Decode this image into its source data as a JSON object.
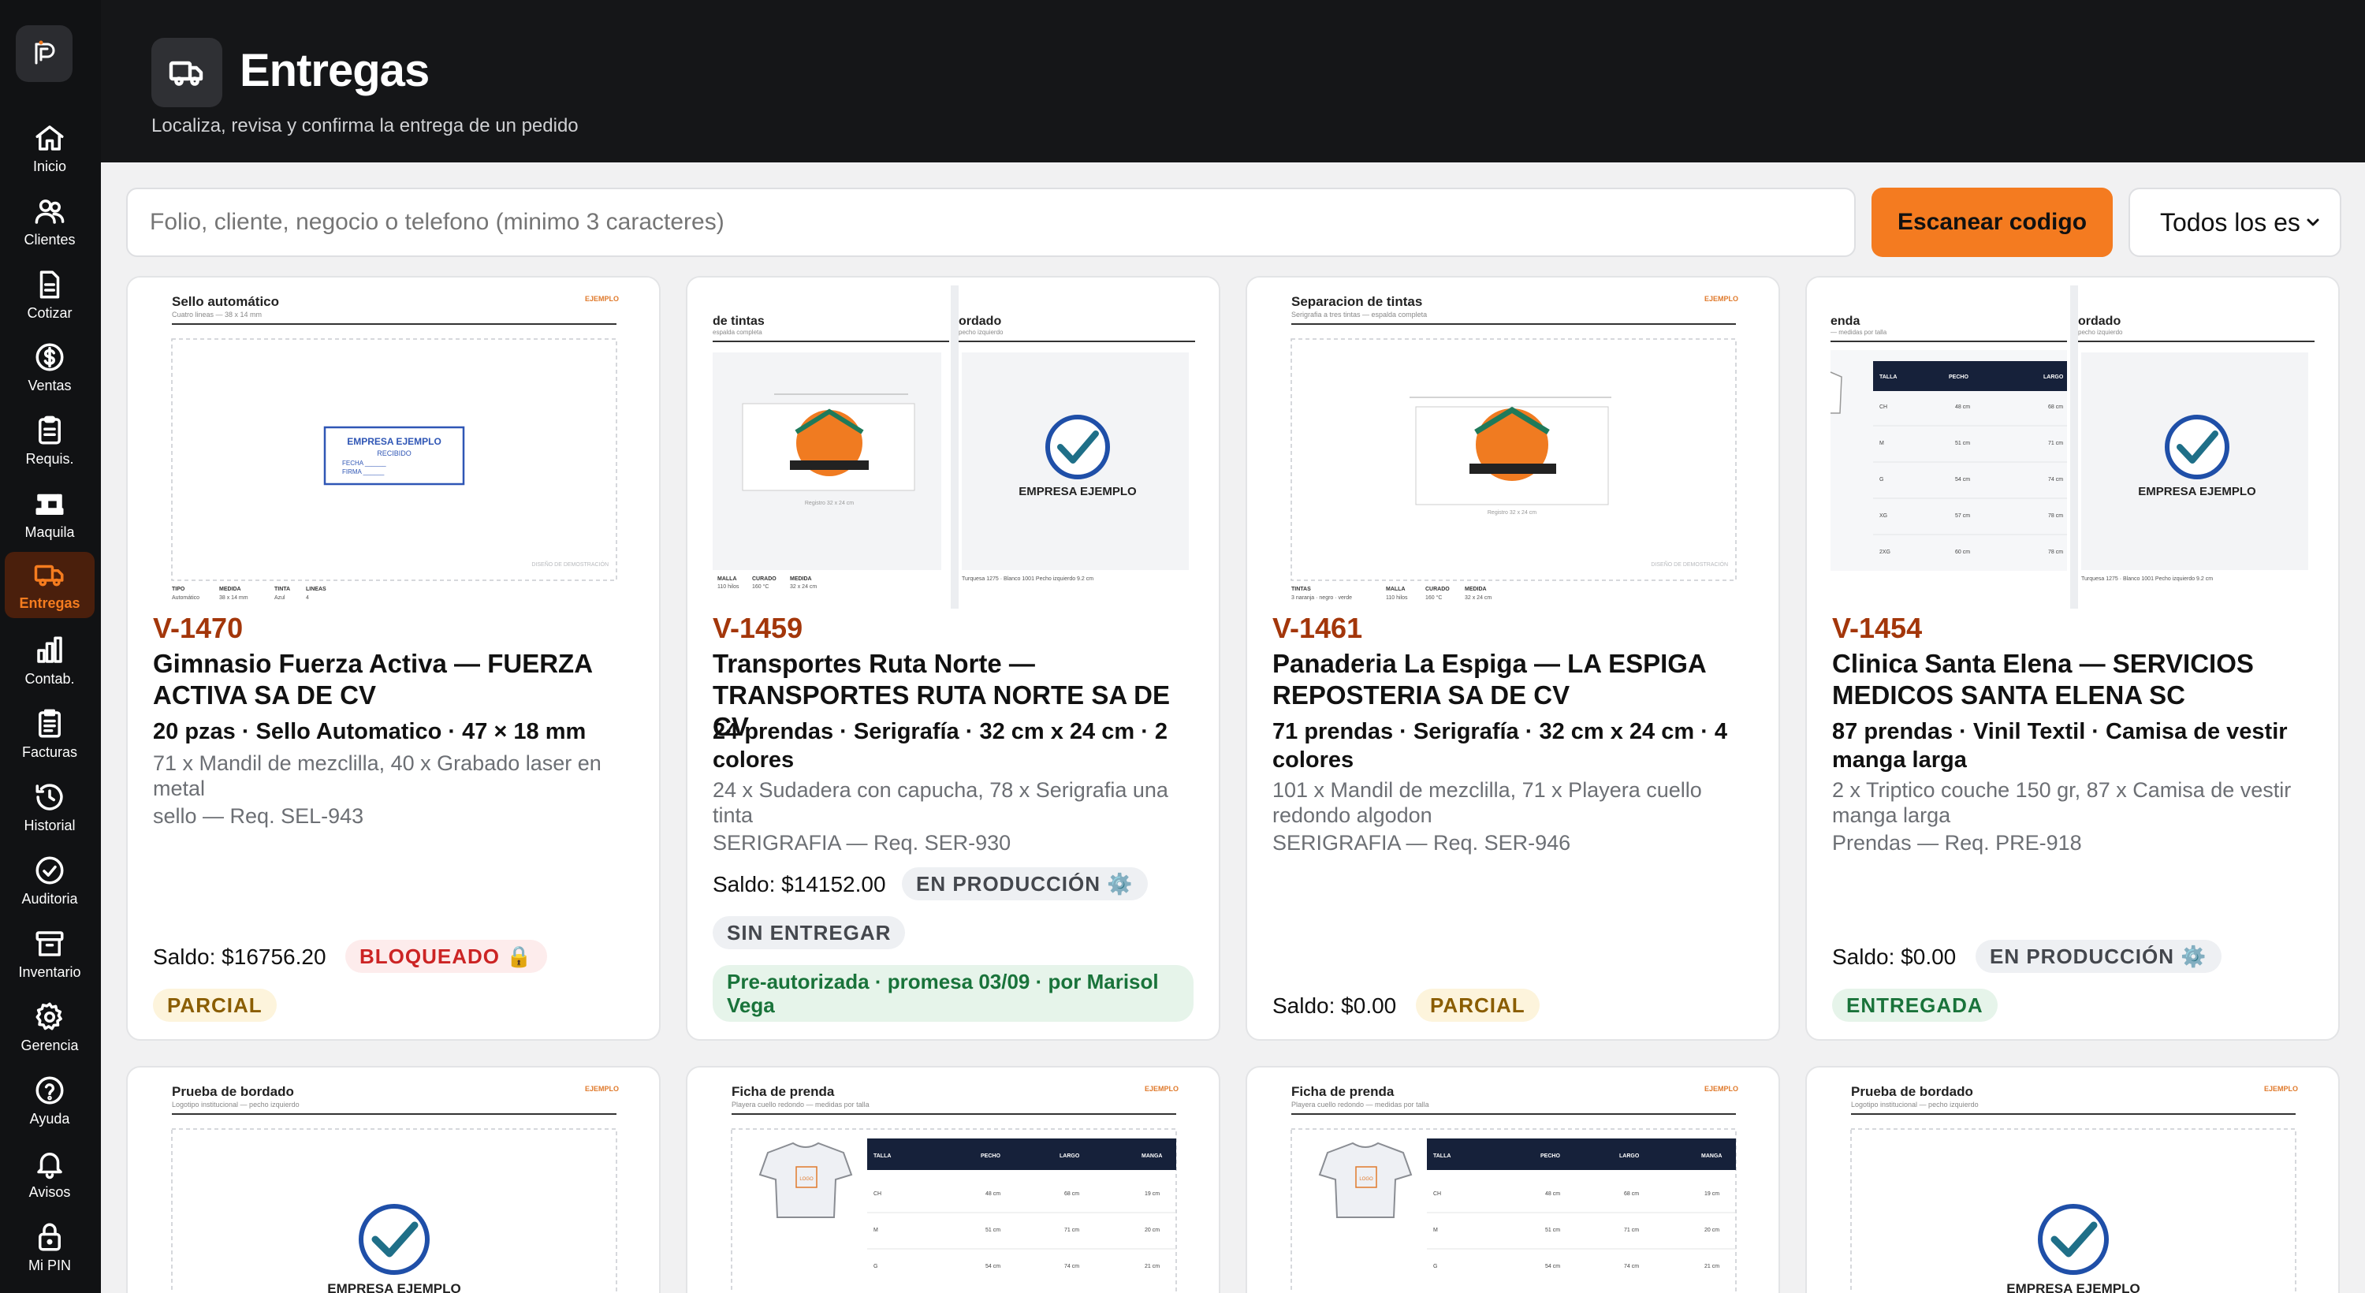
{
  "sidebar": {
    "items": [
      {
        "label": "Inicio",
        "icon": "home-icon"
      },
      {
        "label": "Clientes",
        "icon": "users-icon"
      },
      {
        "label": "Cotizar",
        "icon": "document-icon"
      },
      {
        "label": "Ventas",
        "icon": "dollar-icon"
      },
      {
        "label": "Requis.",
        "icon": "clipboard-icon"
      },
      {
        "label": "Maquila",
        "icon": "sewing-machine-icon"
      },
      {
        "label": "Entregas",
        "icon": "truck-icon",
        "active": true
      },
      {
        "label": "Contab.",
        "icon": "bar-chart-icon"
      },
      {
        "label": "Facturas",
        "icon": "invoice-icon"
      },
      {
        "label": "Historial",
        "icon": "history-icon"
      },
      {
        "label": "Auditoria",
        "icon": "check-circle-icon"
      },
      {
        "label": "Inventario",
        "icon": "archive-icon"
      },
      {
        "label": "Gerencia",
        "icon": "gear-icon"
      },
      {
        "label": "Ayuda",
        "icon": "help-icon"
      },
      {
        "label": "Avisos",
        "icon": "bell-icon"
      },
      {
        "label": "Mi PIN",
        "icon": "lock-icon"
      }
    ]
  },
  "header": {
    "title": "Entregas",
    "subtitle": "Localiza, revisa y confirma la entrega de un pedido"
  },
  "toolbar": {
    "search_placeholder": "Folio, cliente, negocio o telefono (minimo 3 caracteres)",
    "scan_label": "Escanear codigo",
    "filter_value": "Todos los es"
  },
  "colors": {
    "accent": "#f47b20",
    "folio": "#a3360a",
    "sidebar_bg": "#111214",
    "header_bg": "#151618"
  },
  "cards": [
    {
      "folio": "V-1470",
      "client": "Gimnasio Fuerza Activa — FUERZA ACTIVA SA DE CV",
      "summary": "20 pzas · Sello Automatico · 47 × 18 mm",
      "items": "71 x Mandil de mezclilla, 40 x Grabado laser en metal",
      "req": "sello — Req. SEL-943",
      "saldo": "Saldo: $16756.20",
      "status": "BLOQUEADO 🔒",
      "delivery": "PARCIAL",
      "thumb": {
        "title": "Sello automático",
        "sub": "Cuatro lineas — 38 x 14 mm",
        "brand": "EJEMPLO",
        "stamp_lines": [
          "EMPRESA EJEMPLO",
          "RECIBIDO",
          "FECHA ______",
          "FIRMA ______"
        ],
        "footer_labels": [
          "TIPO",
          "MEDIDA",
          "TINTA",
          "LINEAS"
        ],
        "footer_values": [
          "Automático",
          "38 x 14 mm",
          "Azul",
          "4"
        ],
        "watermark": "DISEÑO DE DEMOSTRACIÓN"
      }
    },
    {
      "folio": "V-1459",
      "client": "Transportes Ruta Norte — TRANSPORTES RUTA NORTE SA DE CV",
      "summary": "24 prendas · Serigrafía · 32 cm x 24 cm · 2 colores",
      "items": "24 x Sudadera con capucha, 78 x Serigrafia una tinta",
      "req": "SERIGRAFIA — Req. SER-930",
      "saldo": "Saldo: $14152.00",
      "status": "EN PRODUCCIÓN ⚙️",
      "delivery": "SIN ENTREGAR",
      "note": "Pre-autorizada · promesa 03/09 · por Marisol Vega",
      "thumb": {
        "title_left": "de tintas",
        "title_right": "ordado",
        "sub_left": "espalda completa",
        "sub_right": "pecho izquierdo",
        "company": "EMPRESA EJEMPLO",
        "size_note": "Registro 32 x 24 cm",
        "footer_left": [
          "MALLA",
          "CURADO",
          "MEDIDA"
        ],
        "footer_left_vals": [
          "110 hilos",
          "160 °C",
          "32 x 24 cm"
        ],
        "footer_right": "Turquesa 1275 · Blanco 1001    Pecho izquierdo    9.2 cm"
      }
    },
    {
      "folio": "V-1461",
      "client": "Panaderia La Espiga — LA ESPIGA REPOSTERIA SA DE CV",
      "summary": "71 prendas · Serigrafía · 32 cm x 24 cm · 4 colores",
      "items": "101 x Mandil de mezclilla, 71 x Playera cuello redondo algodon",
      "req": "SERIGRAFIA — Req. SER-946",
      "saldo": "Saldo: $0.00",
      "status": "",
      "delivery": "PARCIAL",
      "thumb": {
        "title": "Separacion de tintas",
        "sub": "Serigrafia a tres tintas — espalda completa",
        "brand": "EJEMPLO",
        "size_note": "Registro 32 x 24 cm",
        "footer_labels": [
          "TINTAS",
          "MALLA",
          "CURADO",
          "MEDIDA"
        ],
        "footer_values": [
          "3 naranja · negro · verde",
          "110 hilos",
          "160 °C",
          "32 x 24 cm"
        ],
        "watermark": "DISEÑO DE DEMOSTRACIÓN"
      }
    },
    {
      "folio": "V-1454",
      "client": "Clinica Santa Elena — SERVICIOS MEDICOS SANTA ELENA SC",
      "summary": "87 prendas · Vinil Textil · Camisa de vestir manga larga",
      "items": "2 x Triptico couche 150 gr, 87 x Camisa de vestir manga larga",
      "req": "Prendas — Req. PRE-918",
      "saldo": "Saldo: $0.00",
      "status": "EN PRODUCCIÓN ⚙️",
      "delivery": "ENTREGADA",
      "thumb": {
        "title_left": "enda",
        "title_right": "ordado",
        "sub_left": "— medidas por talla",
        "sub_right": "pecho izquierdo",
        "company": "EMPRESA EJEMPLO",
        "table_headers": [
          "TALLA",
          "PECHO",
          "LARGO"
        ],
        "table_rows": [
          [
            "CH",
            "48 cm",
            "68 cm"
          ],
          [
            "M",
            "51 cm",
            "71 cm"
          ],
          [
            "G",
            "54 cm",
            "74 cm"
          ],
          [
            "XG",
            "57 cm",
            "78 cm"
          ],
          [
            "2XG",
            "60 cm",
            "78 cm"
          ]
        ],
        "footer_right": "Turquesa 1275 · Blanco 1001    Pecho izquierdo    9.2 cm"
      }
    },
    {
      "thumb": {
        "title": "Prueba de bordado",
        "sub": "Logotipo institucional — pecho izquierdo",
        "brand": "EJEMPLO",
        "company": "EMPRESA EJEMPLO"
      }
    },
    {
      "thumb": {
        "title": "Ficha de prenda",
        "sub": "Playera cuello redondo — medidas por talla",
        "brand": "EJEMPLO",
        "logo_text": "LOGO",
        "table_headers": [
          "TALLA",
          "PECHO",
          "LARGO",
          "MANGA"
        ],
        "table_rows": [
          [
            "CH",
            "48 cm",
            "68 cm",
            "19 cm"
          ],
          [
            "M",
            "51 cm",
            "71 cm",
            "20 cm"
          ],
          [
            "G",
            "54 cm",
            "74 cm",
            "21 cm"
          ]
        ]
      }
    },
    {
      "thumb": {
        "title": "Ficha de prenda",
        "sub": "Playera cuello redondo — medidas por talla",
        "brand": "EJEMPLO",
        "logo_text": "LOGO",
        "table_headers": [
          "TALLA",
          "PECHO",
          "LARGO",
          "MANGA"
        ],
        "table_rows": [
          [
            "CH",
            "48 cm",
            "68 cm",
            "19 cm"
          ],
          [
            "M",
            "51 cm",
            "71 cm",
            "20 cm"
          ],
          [
            "G",
            "54 cm",
            "74 cm",
            "21 cm"
          ]
        ]
      }
    },
    {
      "thumb": {
        "title": "Prueba de bordado",
        "sub": "Logotipo institucional — pecho izquierdo",
        "brand": "EJEMPLO",
        "company": "EMPRESA EJEMPLO"
      }
    }
  ]
}
